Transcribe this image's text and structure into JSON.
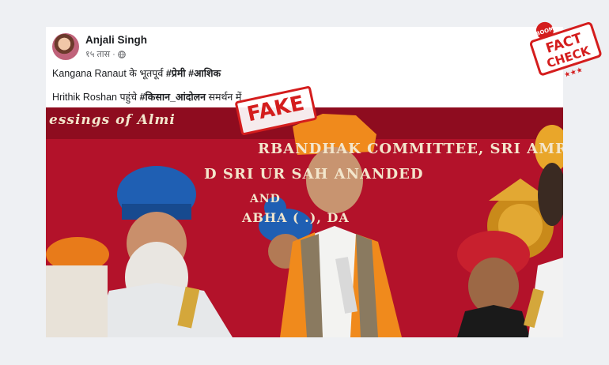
{
  "post": {
    "author": "Anjali Singh",
    "time": "१५ तास",
    "separator": "·",
    "line1_text": "Kangana Ranaut के भूतपूर्व ",
    "line1_tag1": "#प्रेमी",
    "line1_tag2": "#आशिक",
    "line2_text": "Hrithik Roshan पहुंचे ",
    "line2_tag": "#किसान_आंदोलन",
    "line2_rest": " समर्थन में"
  },
  "photo": {
    "banner_line1": "essings of Almi",
    "banner_line2": "RBANDHAK COMMITTEE, SRI AMRITSA",
    "banner_line3": "D SRI    UR SAH      ANANDED",
    "banner_line4": "AND",
    "banner_line5": "ABHA (   .),  DA",
    "fake_label": "FAKE"
  },
  "badge": {
    "brand": "BOOM",
    "line1": "FACT",
    "line2": "CHECK",
    "stars": "★★★"
  },
  "colors": {
    "banner_bg": "#b3122a",
    "stamp_red": "#d41d1d",
    "turban_blue": "#1f5fb3",
    "turban_orange": "#f08a1c"
  }
}
